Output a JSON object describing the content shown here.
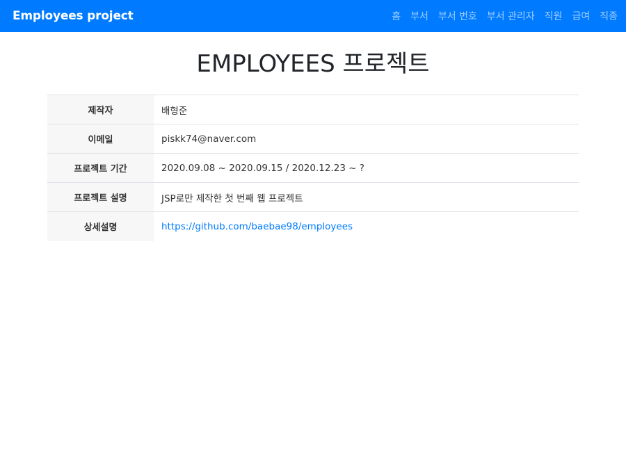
{
  "navbar": {
    "brand": "Employees project",
    "links": [
      "홈",
      "부서",
      "부서 번호",
      "부서 관리자",
      "직원",
      "급여",
      "직종"
    ]
  },
  "page": {
    "title": "EMPLOYEES 프로젝트"
  },
  "info": {
    "rows": [
      {
        "label": "제작자",
        "value": "배형준"
      },
      {
        "label": "이메일",
        "value": "piskk74@naver.com"
      },
      {
        "label": "프로젝트 기간",
        "value": "2020.09.08 ~ 2020.09.15 / 2020.12.23 ~ ?"
      },
      {
        "label": "프로젝트 설명",
        "value": "JSP로만 제작한 첫 번째 웹 프로젝트"
      },
      {
        "label": "상세설명",
        "value": "https://github.com/baebae98/employees"
      }
    ]
  },
  "colors": {
    "navbar_bg": "#007bff",
    "link": "#007bff",
    "header_cell_bg": "#f7f7f7"
  }
}
